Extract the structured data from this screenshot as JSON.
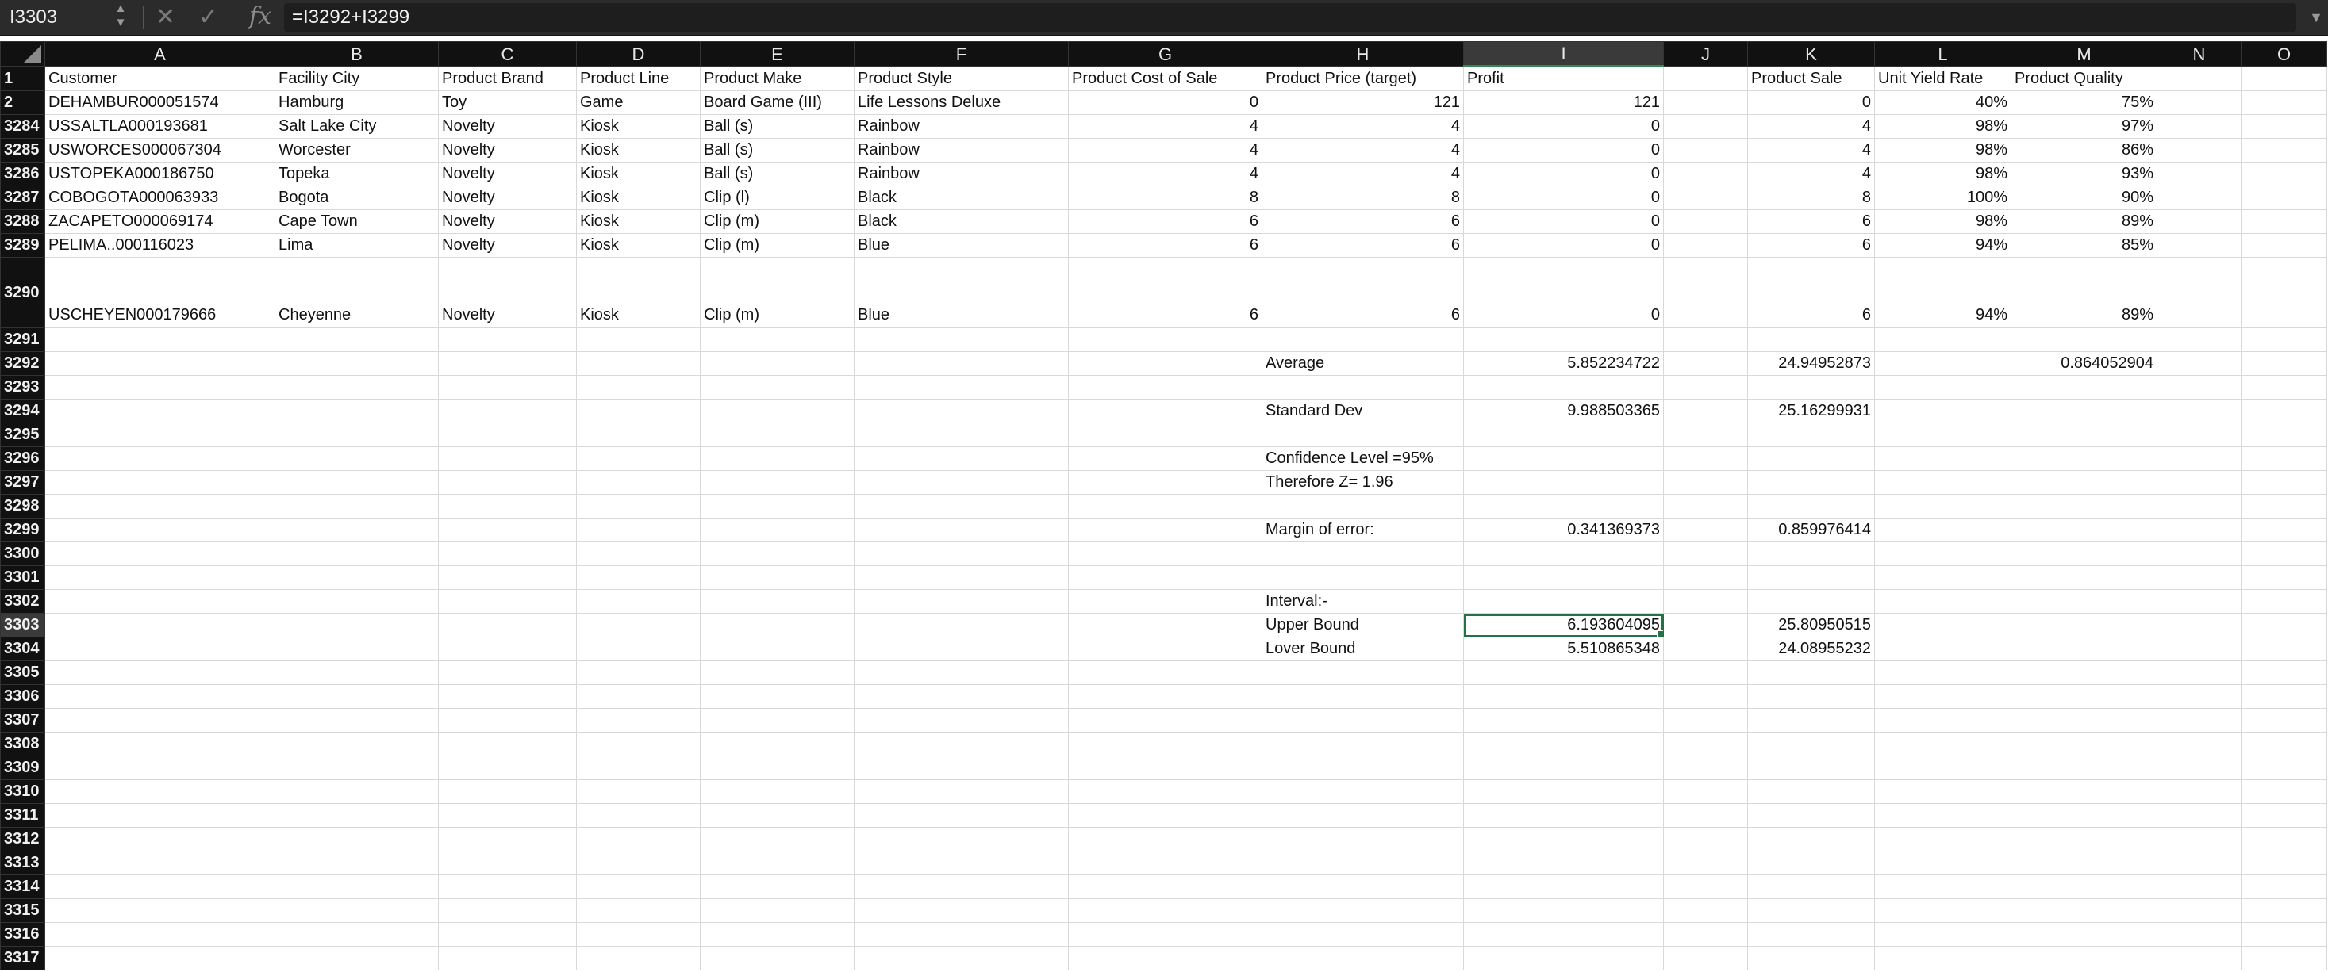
{
  "formula_bar": {
    "cell_ref": "I3303",
    "formula": "=I3292+I3299",
    "fx_label": "fx"
  },
  "columns": [
    "A",
    "B",
    "C",
    "D",
    "E",
    "F",
    "G",
    "H",
    "I",
    "J",
    "K",
    "L",
    "M",
    "N",
    "O"
  ],
  "selected_cell": "I3303",
  "rows": [
    {
      "n": "1",
      "c": [
        "Customer",
        "Facility City",
        "Product Brand",
        "Product Line",
        "Product Make",
        "Product Style",
        "Product Cost of Sale",
        "Product Price (target)",
        "Profit",
        "",
        "Product Sale",
        "Unit Yield Rate",
        "Product Quality",
        "",
        ""
      ]
    },
    {
      "n": "2",
      "c": [
        "DEHAMBUR000051574",
        "Hamburg",
        "Toy",
        "Game",
        "Board Game (III)",
        "Life Lessons Deluxe",
        "0",
        "121",
        "121",
        "",
        "0",
        "40%",
        "75%",
        "",
        ""
      ]
    },
    {
      "n": "3284",
      "c": [
        "USSALTLA000193681",
        "Salt Lake City",
        "Novelty",
        "Kiosk",
        "Ball (s)",
        "Rainbow",
        "4",
        "4",
        "0",
        "",
        "4",
        "98%",
        "97%",
        "",
        ""
      ]
    },
    {
      "n": "3285",
      "c": [
        "USWORCES000067304",
        "Worcester",
        "Novelty",
        "Kiosk",
        "Ball (s)",
        "Rainbow",
        "4",
        "4",
        "0",
        "",
        "4",
        "98%",
        "86%",
        "",
        ""
      ]
    },
    {
      "n": "3286",
      "c": [
        "USTOPEKA000186750",
        "Topeka",
        "Novelty",
        "Kiosk",
        "Ball (s)",
        "Rainbow",
        "4",
        "4",
        "0",
        "",
        "4",
        "98%",
        "93%",
        "",
        ""
      ]
    },
    {
      "n": "3287",
      "c": [
        "COBOGOTA000063933",
        "Bogota",
        "Novelty",
        "Kiosk",
        "Clip (l)",
        "Black",
        "8",
        "8",
        "0",
        "",
        "8",
        "100%",
        "90%",
        "",
        ""
      ]
    },
    {
      "n": "3288",
      "c": [
        "ZACAPETO000069174",
        "Cape Town",
        "Novelty",
        "Kiosk",
        "Clip (m)",
        "Black",
        "6",
        "6",
        "0",
        "",
        "6",
        "98%",
        "89%",
        "",
        ""
      ]
    },
    {
      "n": "3289",
      "c": [
        "PELIMA..000116023",
        "Lima",
        "Novelty",
        "Kiosk",
        "Clip (m)",
        "Blue",
        "6",
        "6",
        "0",
        "",
        "6",
        "94%",
        "85%",
        "",
        ""
      ]
    },
    {
      "n": "3290",
      "tall": true,
      "c": [
        "USCHEYEN000179666",
        "Cheyenne",
        "Novelty",
        "Kiosk",
        "Clip (m)",
        "Blue",
        "6",
        "6",
        "0",
        "",
        "6",
        "94%",
        "89%",
        "",
        ""
      ]
    },
    {
      "n": "3291",
      "c": [
        "",
        "",
        "",
        "",
        "",
        "",
        "",
        "",
        "",
        "",
        "",
        "",
        "",
        "",
        ""
      ]
    },
    {
      "n": "3292",
      "c": [
        "",
        "",
        "",
        "",
        "",
        "",
        "",
        "Average",
        "5.852234722",
        "",
        "24.94952873",
        "",
        "0.864052904",
        "",
        ""
      ]
    },
    {
      "n": "3293",
      "c": [
        "",
        "",
        "",
        "",
        "",
        "",
        "",
        "",
        "",
        "",
        "",
        "",
        "",
        "",
        ""
      ]
    },
    {
      "n": "3294",
      "c": [
        "",
        "",
        "",
        "",
        "",
        "",
        "",
        "Standard Dev",
        "9.988503365",
        "",
        "25.16299931",
        "",
        "",
        "",
        ""
      ]
    },
    {
      "n": "3295",
      "c": [
        "",
        "",
        "",
        "",
        "",
        "",
        "",
        "",
        "",
        "",
        "",
        "",
        "",
        "",
        ""
      ]
    },
    {
      "n": "3296",
      "c": [
        "",
        "",
        "",
        "",
        "",
        "",
        "",
        "Confidence Level =95%",
        "",
        "",
        "",
        "",
        "",
        "",
        ""
      ]
    },
    {
      "n": "3297",
      "c": [
        "",
        "",
        "",
        "",
        "",
        "",
        "",
        "Therefore Z= 1.96",
        "",
        "",
        "",
        "",
        "",
        "",
        ""
      ]
    },
    {
      "n": "3298",
      "c": [
        "",
        "",
        "",
        "",
        "",
        "",
        "",
        "",
        "",
        "",
        "",
        "",
        "",
        "",
        ""
      ]
    },
    {
      "n": "3299",
      "c": [
        "",
        "",
        "",
        "",
        "",
        "",
        "",
        "Margin of error:",
        "0.341369373",
        "",
        "0.859976414",
        "",
        "",
        "",
        ""
      ]
    },
    {
      "n": "3300",
      "c": [
        "",
        "",
        "",
        "",
        "",
        "",
        "",
        "",
        "",
        "",
        "",
        "",
        "",
        "",
        ""
      ]
    },
    {
      "n": "3301",
      "c": [
        "",
        "",
        "",
        "",
        "",
        "",
        "",
        "",
        "",
        "",
        "",
        "",
        "",
        "",
        ""
      ]
    },
    {
      "n": "3302",
      "c": [
        "",
        "",
        "",
        "",
        "",
        "",
        "",
        "Interval:-",
        "",
        "",
        "",
        "",
        "",
        "",
        ""
      ]
    },
    {
      "n": "3303",
      "c": [
        "",
        "",
        "",
        "",
        "",
        "",
        "",
        "Upper Bound",
        "6.193604095",
        "",
        "25.80950515",
        "",
        "",
        "",
        ""
      ]
    },
    {
      "n": "3304",
      "c": [
        "",
        "",
        "",
        "",
        "",
        "",
        "",
        "Lover Bound",
        "5.510865348",
        "",
        "24.08955232",
        "",
        "",
        "",
        ""
      ]
    },
    {
      "n": "3305",
      "c": [
        "",
        "",
        "",
        "",
        "",
        "",
        "",
        "",
        "",
        "",
        "",
        "",
        "",
        "",
        ""
      ]
    },
    {
      "n": "3306",
      "c": [
        "",
        "",
        "",
        "",
        "",
        "",
        "",
        "",
        "",
        "",
        "",
        "",
        "",
        "",
        ""
      ]
    },
    {
      "n": "3307",
      "c": [
        "",
        "",
        "",
        "",
        "",
        "",
        "",
        "",
        "",
        "",
        "",
        "",
        "",
        "",
        ""
      ]
    },
    {
      "n": "3308",
      "c": [
        "",
        "",
        "",
        "",
        "",
        "",
        "",
        "",
        "",
        "",
        "",
        "",
        "",
        "",
        ""
      ]
    },
    {
      "n": "3309",
      "c": [
        "",
        "",
        "",
        "",
        "",
        "",
        "",
        "",
        "",
        "",
        "",
        "",
        "",
        "",
        ""
      ]
    },
    {
      "n": "3310",
      "c": [
        "",
        "",
        "",
        "",
        "",
        "",
        "",
        "",
        "",
        "",
        "",
        "",
        "",
        "",
        ""
      ]
    },
    {
      "n": "3311",
      "c": [
        "",
        "",
        "",
        "",
        "",
        "",
        "",
        "",
        "",
        "",
        "",
        "",
        "",
        "",
        ""
      ]
    },
    {
      "n": "3312",
      "c": [
        "",
        "",
        "",
        "",
        "",
        "",
        "",
        "",
        "",
        "",
        "",
        "",
        "",
        "",
        ""
      ]
    },
    {
      "n": "3313",
      "c": [
        "",
        "",
        "",
        "",
        "",
        "",
        "",
        "",
        "",
        "",
        "",
        "",
        "",
        "",
        ""
      ]
    },
    {
      "n": "3314",
      "c": [
        "",
        "",
        "",
        "",
        "",
        "",
        "",
        "",
        "",
        "",
        "",
        "",
        "",
        "",
        ""
      ]
    },
    {
      "n": "3315",
      "c": [
        "",
        "",
        "",
        "",
        "",
        "",
        "",
        "",
        "",
        "",
        "",
        "",
        "",
        "",
        ""
      ]
    },
    {
      "n": "3316",
      "c": [
        "",
        "",
        "",
        "",
        "",
        "",
        "",
        "",
        "",
        "",
        "",
        "",
        "",
        "",
        ""
      ]
    },
    {
      "n": "3317",
      "c": [
        "",
        "",
        "",
        "",
        "",
        "",
        "",
        "",
        "",
        "",
        "",
        "",
        "",
        "",
        ""
      ]
    }
  ]
}
